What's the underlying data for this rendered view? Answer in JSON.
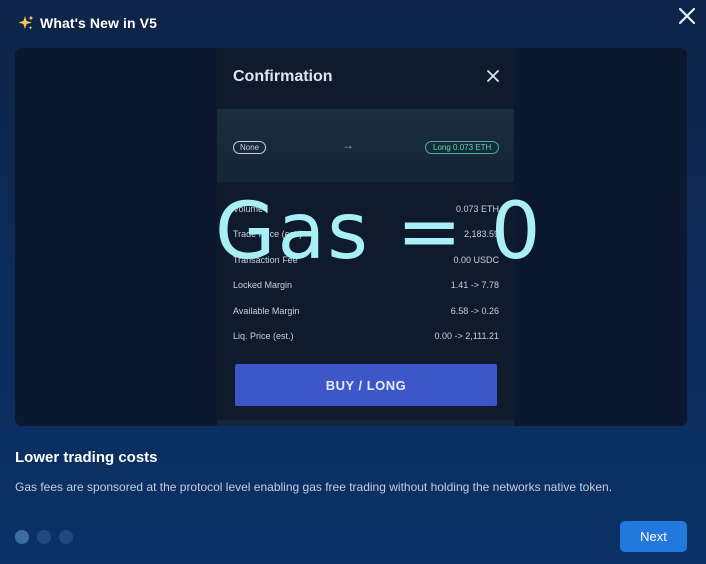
{
  "dialog": {
    "title": "What's New in V5",
    "icon": "sparkles-icon",
    "accent": "#2178dd"
  },
  "preview": {
    "confirmation_title": "Confirmation",
    "from_position": "None",
    "to_position": "Long 0.073 ETH",
    "rows": [
      {
        "label": "Volume",
        "value": "0.073 ETH"
      },
      {
        "label": "Trade Price (est.)",
        "value": "2,183.59"
      },
      {
        "label": "Transaction Fee",
        "value": "0.00 USDC"
      },
      {
        "label": "Locked Margin",
        "value": "1.41 -> 7.78"
      },
      {
        "label": "Available Margin",
        "value": "6.58 -> 0.26"
      },
      {
        "label": "Liq. Price (est.)",
        "value": "0.00 -> 2,111.21"
      }
    ],
    "overlay_text": "Gas = 0",
    "buy_button": "BUY / LONG"
  },
  "feature": {
    "title": "Lower trading costs",
    "description": "Gas fees are sponsored at the protocol level enabling gas free trading without holding the networks native token."
  },
  "pagination": {
    "current": 1,
    "total": 3
  },
  "next_button": "Next"
}
